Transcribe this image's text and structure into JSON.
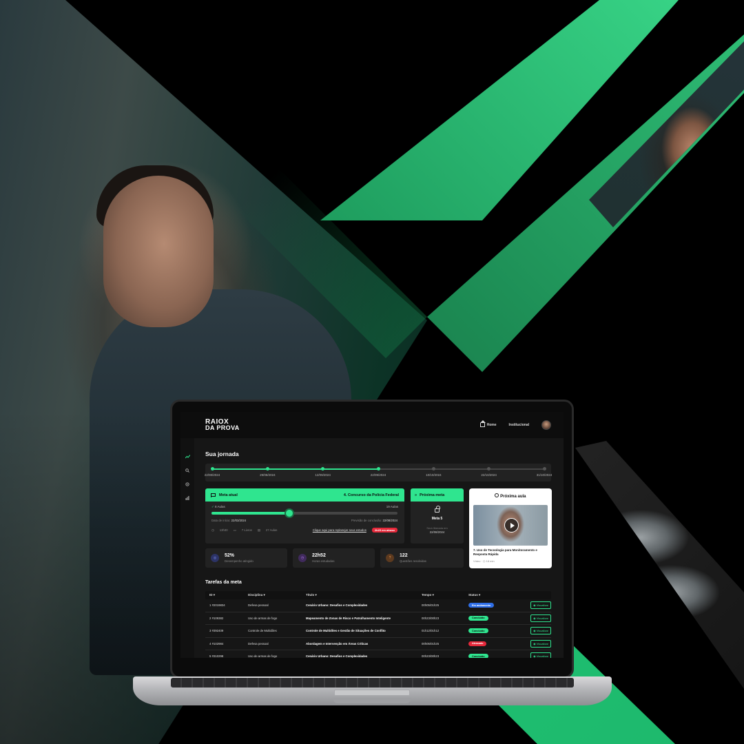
{
  "brand": {
    "line1": "RAIOX",
    "line2": "DA PROVA"
  },
  "nav": {
    "home": "Home",
    "institutional": "Institucional"
  },
  "sidebar": {
    "icons": [
      "trend-icon",
      "search-icon",
      "settings-icon",
      "chart-icon"
    ]
  },
  "journey": {
    "title": "Sua jornada",
    "progress_fraction": 0.5,
    "dates": [
      "22/08/2024",
      "29/08/2024",
      "12/09/2024",
      "22/09/2024",
      "10/10/2024",
      "22/10/2024",
      "31/10/2024"
    ],
    "completed_points": 4
  },
  "current_goal": {
    "label": "Meta atual",
    "contest": "4. Concurso da Polícia Federal",
    "done_lessons": "8 Aulas",
    "total_lessons": "19 Aulas",
    "progress_percent": 42,
    "start_label": "Data de início:",
    "start_date": "22/03/2024",
    "forecast_label": "Previsão de conclusão:",
    "forecast_date": "22/08/2024",
    "hours": "13h30",
    "lectures": "7 Livros",
    "classes": "27 Aulas",
    "replan_link": "Clique aqui para replanejar seus estudos",
    "late_badge": "2h25 em atraso"
  },
  "next_goal": {
    "label": "Próxima meta",
    "name": "Meta 5",
    "unlock_text": "Será liberada em",
    "unlock_date": "22/08/2024"
  },
  "next_lesson": {
    "label": "Próxima aula",
    "title": "7. Uso de Tecnologia para Monitoramento e Resposta Rápida",
    "type": "Vídeo",
    "duration": "18 min"
  },
  "stats": [
    {
      "value": "52%",
      "label": "Desempenho atingido",
      "icon": "target-icon",
      "color": "#5b6fe8"
    },
    {
      "value": "22h52",
      "label": "Horas estudadas",
      "icon": "clock-icon",
      "color": "#a45be8"
    },
    {
      "value": "122",
      "label": "Questões resolvidas",
      "icon": "questions-icon",
      "color": "#e8812f"
    }
  ],
  "tasks": {
    "title": "Tarefas da meta",
    "headers": {
      "id": "ID",
      "discipline": "Disciplina",
      "title": "Título",
      "time": "Tempo",
      "status": "Status"
    },
    "view_label": "Visualizar",
    "rows": [
      {
        "id": "1 #2019834",
        "discipline": "Defesa pessoal",
        "title": "Cenário Urbano: Desafios e Complexidades",
        "time": "00h05/01h25",
        "status": "Em andamento",
        "status_color": "#2f6fe8"
      },
      {
        "id": "2 #109382",
        "discipline": "Uso de armas de fogo",
        "title": "Mapeamento de Zonas de Risco e Patrulhamento Inteligente",
        "time": "00h23/00h23",
        "status": "Concluído",
        "status_color": "#2fe58f"
      },
      {
        "id": "3 #392409",
        "discipline": "Controle de Multidões",
        "title": "Controle de Multidões e Gestão de Situações de Conflito",
        "time": "01h12/01h12",
        "status": "Concluído",
        "status_color": "#2fe58f"
      },
      {
        "id": "4 #102984",
        "discipline": "Defesa pessoal",
        "title": "Abordagem e Intervenção em Áreas Críticas",
        "time": "00h05/01h25",
        "status": "Atrasado",
        "status_color": "#e5283a"
      },
      {
        "id": "5 #310298",
        "discipline": "Uso de armas de fogo",
        "title": "Cenário Urbano: Desafios e Complexidades",
        "time": "00h23/00h23",
        "status": "Concluído",
        "status_color": "#2fe58f"
      }
    ]
  },
  "colors": {
    "accent": "#2fe58f",
    "danger": "#e5283a",
    "panel": "#222222",
    "background": "#161616"
  }
}
